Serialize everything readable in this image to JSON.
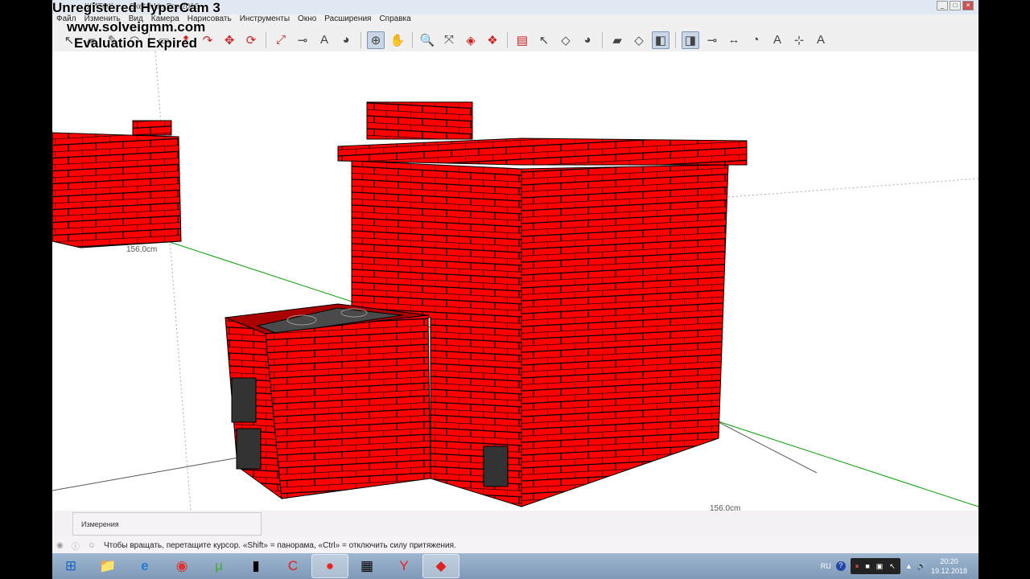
{
  "window": {
    "title": "ШИТОК ... - SketchUp Pro 2016"
  },
  "watermark": {
    "line1": "Unregistered HyperCam 3",
    "line2": "www.solveigmm.com",
    "line3": "Evaluation Expired"
  },
  "menu": [
    "Файл",
    "Изменить",
    "Вид",
    "Камера",
    "Нарисовать",
    "Инструменты",
    "Окно",
    "Расширения",
    "Справка"
  ],
  "toolbar": {
    "icons": [
      "select",
      "eraser",
      "pencil",
      "arc",
      "rectangle",
      "push-pull",
      "follow-me",
      "move",
      "rotate",
      "scale",
      "tape-measure",
      "text",
      "paint-bucket",
      "orbit",
      "pan",
      "zoom",
      "zoom-extents",
      "section",
      "components",
      "warehouse",
      "select2",
      "component2",
      "paint2",
      "eraser2",
      "orbit2",
      "view-iso",
      "view-top",
      "tape2",
      "dimension",
      "protractor",
      "text2",
      "axes",
      "3d-text"
    ],
    "active": [
      "orbit",
      "view-iso",
      "view-top"
    ]
  },
  "viewport": {
    "dimension_left": "156,0cm",
    "dimension_right": "156,0cm",
    "brick_color": "#ff0000",
    "axis_green": "#00a000",
    "axis_red": "#cc0000"
  },
  "measurements": {
    "label": "Измерения"
  },
  "status": {
    "text": "Чтобы вращать, перетащите курсор. «Shift» = панорама, «Ctrl» = отключить силу притяжения."
  },
  "taskbar": {
    "apps": [
      "start",
      "explorer",
      "internet-explorer",
      "chrome",
      "utorrent",
      "system-tool",
      "ccleaner",
      "hypercam",
      "calculator",
      "yandex",
      "sketchup"
    ],
    "tray": {
      "lang": "RU",
      "time": "20:20",
      "date": "19.12.2018"
    }
  }
}
